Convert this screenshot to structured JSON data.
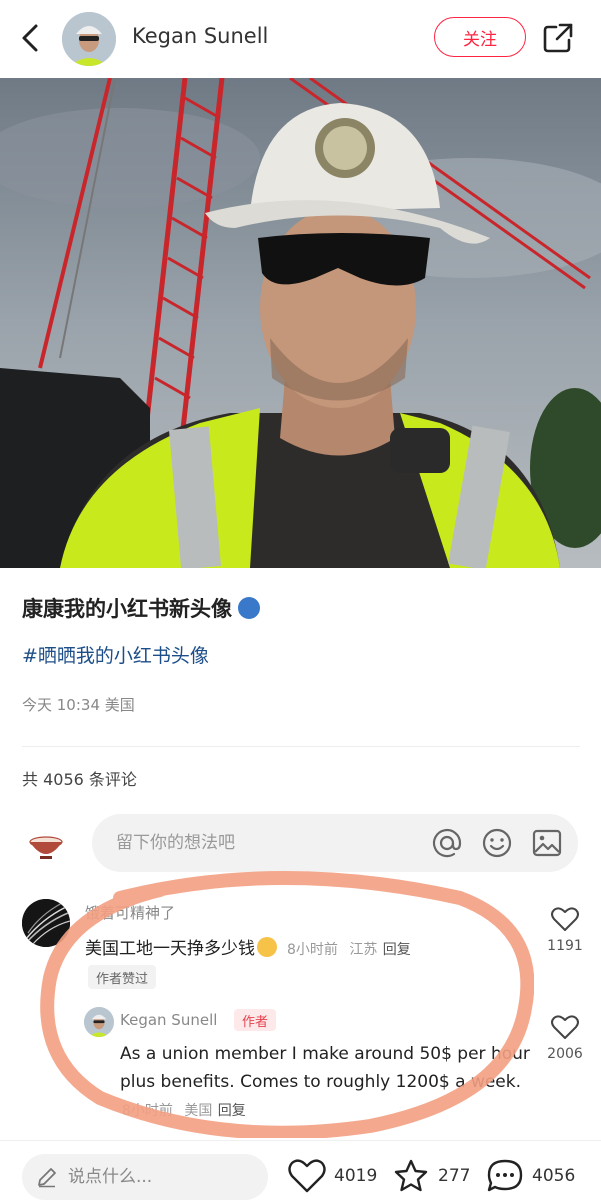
{
  "header": {
    "author_name": "Kegan Sunell",
    "follow_label": "关注"
  },
  "post": {
    "title": "康康我的小红书新头像",
    "title_emoji": "speaking-head-emoji",
    "hashtag": "#晒晒我的小红书头像",
    "meta": "今天 10:34 美国"
  },
  "comments_header": {
    "count_text": "共 4056 条评论"
  },
  "comment_input": {
    "placeholder": "留下你的想法吧"
  },
  "comment": {
    "username": "饿着可精神了",
    "text": "美国工地一天挣多少钱",
    "time": "8小时前",
    "location": "江苏",
    "reply_label": "回复",
    "badge": "作者赞过",
    "likes": "1191"
  },
  "reply": {
    "username": "Kegan Sunell",
    "author_tag": "作者",
    "text": "As a union member I make around 50$ per hour plus benefits.  Comes to roughly 1200$ a week.",
    "time": "8小时前",
    "location": "美国",
    "reply_label": "回复",
    "likes": "2006"
  },
  "bottom_bar": {
    "placeholder": "说点什么...",
    "likes": "4019",
    "stars": "277",
    "comments": "4056"
  },
  "colors": {
    "accent": "#ff2442",
    "hashtag": "#1d4e89",
    "annotation": "#f3a082"
  }
}
